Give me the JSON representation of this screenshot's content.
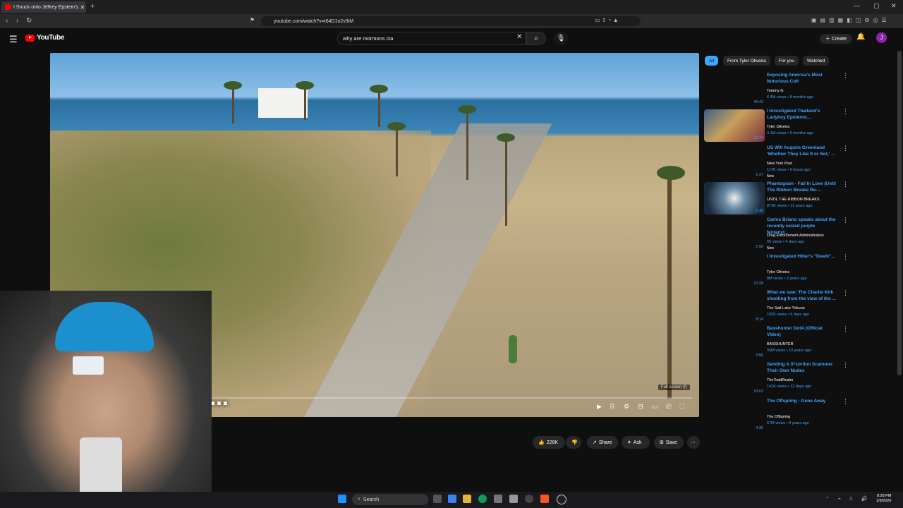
{
  "browser": {
    "tab_title": "I Snuck onto Jeffrey Epstein's...",
    "new_tab": "+",
    "url": "youtube.com/watch?v=t64D1o2v9iM",
    "window_controls": [
      "—",
      "▢",
      "✕"
    ]
  },
  "youtube": {
    "logo_text": "YouTube",
    "search_query": "why are mormons cia",
    "create_label": "Create",
    "avatar_letter": "J"
  },
  "video": {
    "caption_text": "...p...",
    "fullscreen_tooltip": "Full screen  (f)"
  },
  "actions": {
    "like_count": "226K",
    "share": "Share",
    "ask": "Ask",
    "save": "Save"
  },
  "chips": [
    "All",
    "From Tyler Oliveira",
    "For you",
    "Watched"
  ],
  "recommendations": [
    {
      "title": "Exposing America's Most Notorious Cult",
      "channel": "Tommy G",
      "meta": "6.4M views • 8 months ago",
      "duration": "40:42",
      "new": ""
    },
    {
      "title": "I Investigated Thailand's Ladyboy Epidemic...",
      "channel": "Tyler Oliveira",
      "meta": "4.1M views • 9 months ago",
      "duration": "32:37",
      "new": ""
    },
    {
      "title": "US Will Acquire Greenland 'Whether They Like It or Not,' ...",
      "channel": "New York Post",
      "meta": "117K views • 6 hours ago",
      "duration": "2:37",
      "new": "New"
    },
    {
      "title": "Phantogram - Fall In Love (Until The Ribbon Breaks Re-...",
      "channel": "UNTIL THE RIBBON BREAKS",
      "meta": "872K views • 11 years ago",
      "duration": "5:36",
      "new": ""
    },
    {
      "title": "Carlos Briano speaks about the recently seized purple fentanyl...",
      "channel": "Drug Enforcement Administration",
      "meta": "55 views • 4 days ago",
      "duration": "1:58",
      "new": "New"
    },
    {
      "title": "I Investigated Hitler's \"Death\"...",
      "channel": "Tyler Oliveira",
      "meta": "8M views • 2 years ago",
      "duration": "12:28",
      "new": ""
    },
    {
      "title": "What we saw: The Charlie Kirk shooting from the view of the ...",
      "channel": "The Salt Lake Tribune",
      "meta": "192K views • 9 days ago",
      "duration": "8:14",
      "new": ""
    },
    {
      "title": "Basshunter DotA (Official Video)",
      "channel": "BASSHUNTER",
      "meta": "93M views • 10 years ago",
      "duration": "3:56",
      "new": ""
    },
    {
      "title": "Sending A S*xortion Scammer Their Own Nudes",
      "channel": "TheToddRealm",
      "meta": "141K views • 12 days ago",
      "duration": "13:02",
      "new": ""
    },
    {
      "title": "The Offspring - Gone Away",
      "channel": "The Offspring",
      "meta": "57M views • 8 years ago",
      "duration": "4:30",
      "new": ""
    }
  ],
  "taskbar": {
    "search_label": "Search",
    "time": "8:28 PM",
    "date": "1/8/2026"
  }
}
